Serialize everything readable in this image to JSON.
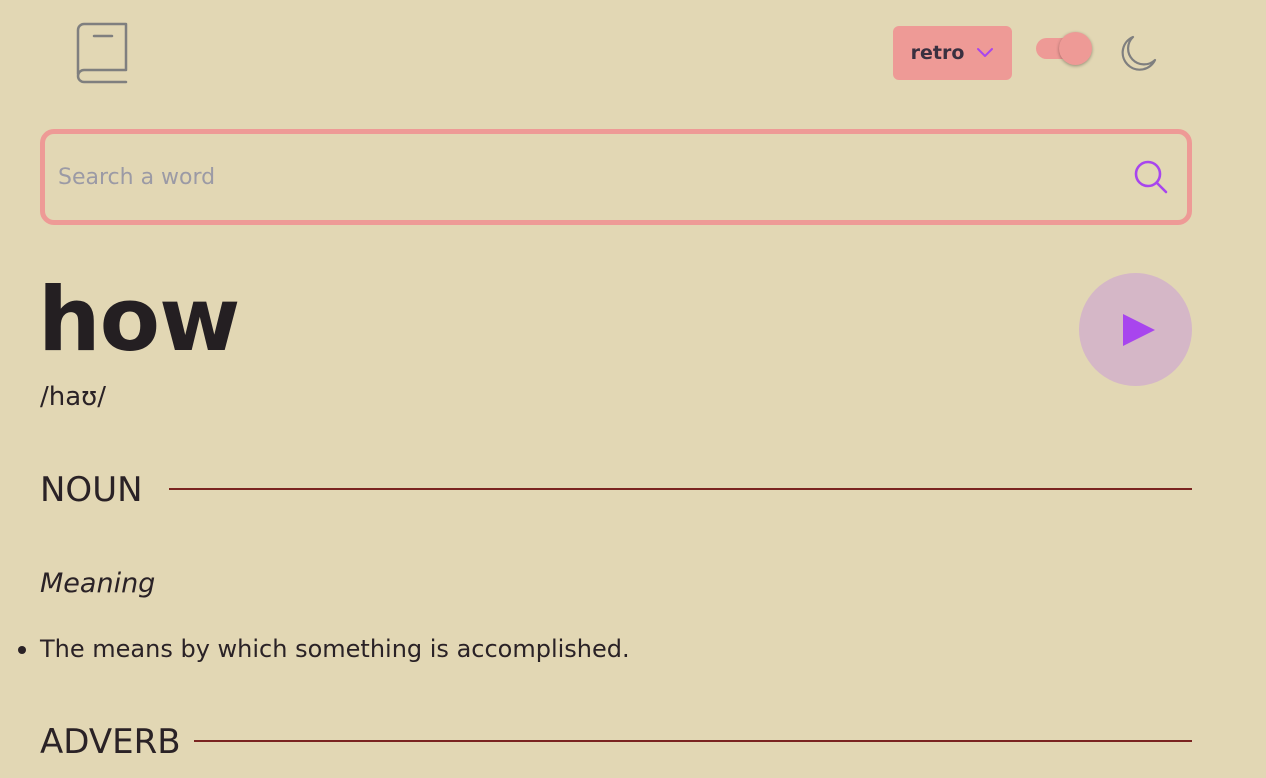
{
  "header": {
    "logo_icon": "book-icon",
    "theme_select": {
      "selected": "retro",
      "icon": "chevron-down-icon"
    },
    "dark_mode_toggle": {
      "state": "on"
    },
    "moon_icon": "moon-icon"
  },
  "search": {
    "placeholder": "Search a word",
    "value": "",
    "icon": "search-icon"
  },
  "entry": {
    "word": "how",
    "phonetic": "/haʊ/",
    "play_icon": "play-icon"
  },
  "meanings": [
    {
      "part_of_speech": "NOUN",
      "label": "Meaning",
      "definitions": [
        "The means by which something is accomplished."
      ]
    },
    {
      "part_of_speech": "ADVERB"
    }
  ],
  "colors": {
    "background": "#e2d7b4",
    "accent": "#ee9a96",
    "purple": "#a845ee",
    "rule": "#7a2420",
    "play_bg": "#d5b7c7"
  }
}
